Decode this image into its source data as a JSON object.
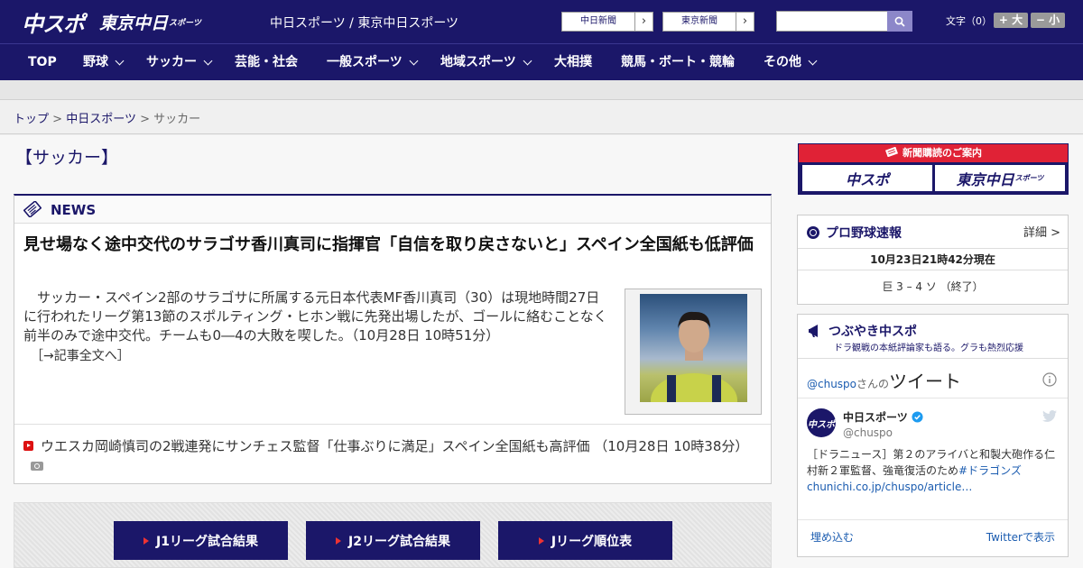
{
  "header": {
    "logo_main": "中スポ",
    "logo_tokyo": "東京中日",
    "logo_tokyo_small": "スポーツ",
    "site_title": "中日スポーツ / 東京中日スポーツ",
    "paper_links": [
      "中日新聞",
      "東京新聞"
    ],
    "search": {
      "placeholder": ""
    },
    "font_size_label": "文字（0）",
    "font_larger": "+ 大",
    "font_smaller": "− 小"
  },
  "nav": {
    "items": [
      {
        "label": "TOP"
      },
      {
        "label": "野球"
      },
      {
        "label": "サッカー"
      },
      {
        "label": "芸能・社会"
      },
      {
        "label": "一般スポーツ"
      },
      {
        "label": "地域スポーツ"
      },
      {
        "label": "大相撲"
      },
      {
        "label": "競馬・ボート・競輪"
      },
      {
        "label": "その他"
      }
    ]
  },
  "breadcrumb": {
    "items": [
      "トップ",
      "中日スポーツ",
      "サッカー"
    ],
    "separator": ">"
  },
  "page_title": "【サッカー】",
  "news": {
    "section_label": "NEWS",
    "headline": "見せ場なく途中交代のサラゴサ香川真司に指揮官「自信を取り戻さないと」スペイン全国紙も低評価",
    "body": "サッカー・スペイン2部のサラゴサに所属する元日本代表MF香川真司（30）は現地時間27日に行われたリーグ第13節のスポルティング・ヒホン戦に先発出場したが、ゴールに絡むことなく前半のみで途中交代。チームも0―4の大敗を喫した。（10月28日 10時51分）",
    "read_more": "［→記事全文へ］",
    "sub_item": "ウエスカ岡崎慎司の2戦連発にサンチェス監督「仕事ぶりに満足」スペイン全国紙も高評価 （10月28日 10時38分）"
  },
  "league_buttons": [
    "J1リーグ試合結果",
    "J2リーグ試合結果",
    "Jリーグ順位表"
  ],
  "sidebar": {
    "subscribe": {
      "title": "新聞購読のご案内",
      "logo_left": "中スポ",
      "logo_right": "東京中日",
      "logo_right_small": "スポーツ"
    },
    "baseball": {
      "title": "プロ野球速報",
      "detail": "詳細 >",
      "timestamp": "10月23日21時42分現在",
      "score": "巨 3 – 4 ソ （終了）"
    },
    "tweets": {
      "title": "つぶやき中スポ",
      "subtitle": "ドラ観戦の本紙評論家も語る。グラも熱烈応援",
      "header_handle": "@chuspo",
      "header_suffix": "さんの",
      "header_tweet": "ツイート",
      "account_name": "中日スポーツ",
      "account_handle": "@chuspo",
      "tweet_text": "［ドラニュース］第２のアライバと和製大砲作る仁村新２軍監督、強竜復活のため",
      "tweet_link": "#ドラゴンズchunichi.co.jp/chuspo/article…",
      "embed": "埋め込む",
      "view_on_twitter": "Twitterで表示"
    }
  },
  "colors": {
    "navy": "#1b1769",
    "red": "#e02236",
    "link_blue": "#1b5cb0",
    "verified_blue": "#1d9bf0"
  }
}
